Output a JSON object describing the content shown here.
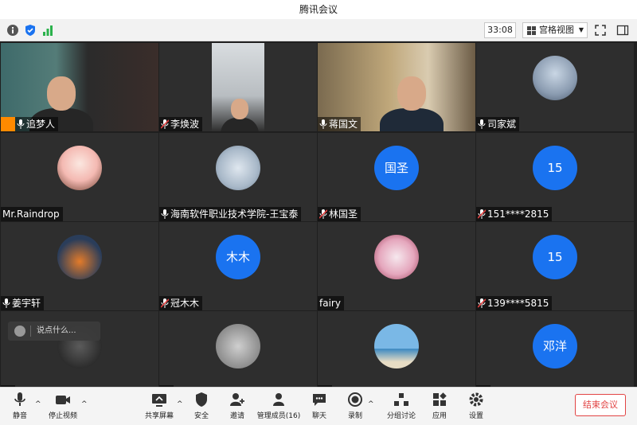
{
  "window": {
    "title": "腾讯会议"
  },
  "top": {
    "timer": "33:08",
    "view_label": "宫格视图"
  },
  "participants": [
    {
      "name": "追梦人",
      "kind": "video",
      "host": true,
      "active": true
    },
    {
      "name": "李焕波",
      "kind": "video",
      "muted": true
    },
    {
      "name": "蒋国文",
      "kind": "video"
    },
    {
      "name": "司家斌",
      "kind": "photo"
    },
    {
      "name": "Mr.Raindrop",
      "kind": "photo",
      "nomic": true
    },
    {
      "name": "海南软件职业技术学院-王宝泰",
      "kind": "photo"
    },
    {
      "name": "林国圣",
      "kind": "text",
      "avatar_text": "国圣",
      "muted": true
    },
    {
      "name": "151****2815",
      "kind": "text",
      "avatar_text": "15",
      "muted": true
    },
    {
      "name": "姜宇轩",
      "kind": "photo"
    },
    {
      "name": "冠木木",
      "kind": "text",
      "avatar_text": "木木",
      "muted": true
    },
    {
      "name": "fairy",
      "kind": "photo",
      "nomic": true
    },
    {
      "name": "139****5815",
      "kind": "text",
      "avatar_text": "15",
      "muted": true
    },
    {
      "name": "",
      "kind": "photo"
    },
    {
      "name": "",
      "kind": "photo"
    },
    {
      "name": "",
      "kind": "photo"
    },
    {
      "name": "",
      "kind": "text",
      "avatar_text": "邓洋"
    }
  ],
  "chat": {
    "placeholder": "说点什么..."
  },
  "bottom": {
    "mute": "静音",
    "stop_video": "停止视频",
    "share": "共享屏幕",
    "security": "安全",
    "invite": "邀请",
    "members": "管理成员(16)",
    "chat": "聊天",
    "record": "录制",
    "breakout": "分组讨论",
    "apps": "应用",
    "settings": "设置",
    "end": "结束会议"
  },
  "colors": {
    "accent": "#1a73f0",
    "active_border": "#17c37b",
    "end": "#e24444",
    "host_badge": "#ff8a00",
    "mute_red": "#e04040"
  }
}
